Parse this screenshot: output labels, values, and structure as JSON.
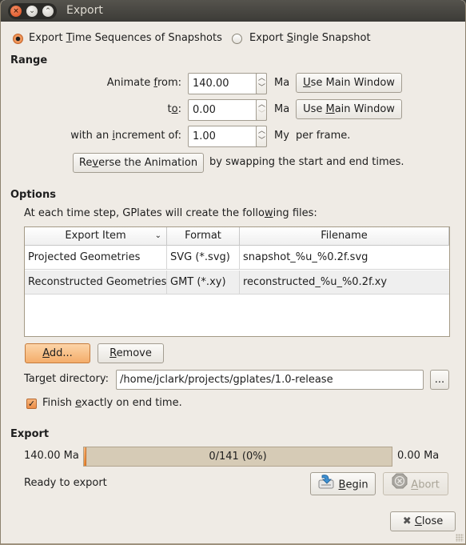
{
  "window": {
    "title": "Export",
    "controls": [
      "close",
      "minimize",
      "maximize"
    ]
  },
  "mode": {
    "options": [
      {
        "label_pre": "Export ",
        "label_mnemonic": "T",
        "label_post": "ime Sequences of Snapshots",
        "selected": true
      },
      {
        "label_pre": "Export ",
        "label_mnemonic": "S",
        "label_post": "ingle Snapshot",
        "selected": false
      }
    ]
  },
  "range": {
    "heading": "Range",
    "from": {
      "label_pre": "Animate ",
      "label_mnemonic": "f",
      "label_post": "rom:",
      "value": "140.00",
      "unit": "Ma",
      "button_mnemonic": "U",
      "button_post": "se Main Window"
    },
    "to": {
      "label_pre": "t",
      "label_mnemonic": "o",
      "label_post": ":",
      "value": "0.00",
      "unit": "Ma",
      "button_pre": "Use ",
      "button_mnemonic": "M",
      "button_post": "ain Window"
    },
    "increment": {
      "label_pre": "with an ",
      "label_mnemonic": "i",
      "label_post": "ncrement of:",
      "value": "1.00",
      "unit": "My",
      "suffix": "per frame."
    },
    "reverse": {
      "button_pre": "Re",
      "button_mnemonic": "v",
      "button_post": "erse the Animation",
      "description": "by swapping the start and end times."
    }
  },
  "options": {
    "heading": "Options",
    "intro_pre": "At each time step, GPlates will create the follo",
    "intro_mnemonic": "w",
    "intro_post": "ing files:",
    "table": {
      "columns": [
        "Export Item",
        "Format",
        "Filename"
      ],
      "rows": [
        {
          "item": "Projected Geometries",
          "format": "SVG (*.svg)",
          "filename": "snapshot_%u_%0.2f.svg"
        },
        {
          "item": "Reconstructed Geometries",
          "format": "GMT (*.xy)",
          "filename": "reconstructed_%u_%0.2f.xy"
        }
      ]
    },
    "add_mnemonic": "A",
    "add_post": "dd...",
    "remove_mnemonic": "R",
    "remove_post": "emove",
    "target_label_pre": "Tar",
    "target_label_mnemonic": "g",
    "target_label_post": "et directory:",
    "target_value": "/home/jclark/projects/gplates/1.0-release",
    "browse_label": "...",
    "finish_pre": "Finish ",
    "finish_mnemonic": "e",
    "finish_post": "xactly on end time.",
    "finish_checked": true
  },
  "export": {
    "heading": "Export",
    "start_label": "140.00 Ma",
    "end_label": "0.00 Ma",
    "progress_text": "0/141 (0%)",
    "progress_fraction": 0.0,
    "status": "Ready to export",
    "begin_mnemonic": "B",
    "begin_post": "egin",
    "abort_mnemonic": "A",
    "abort_post": "bort"
  },
  "footer": {
    "close_mnemonic": "C",
    "close_post": "lose"
  }
}
